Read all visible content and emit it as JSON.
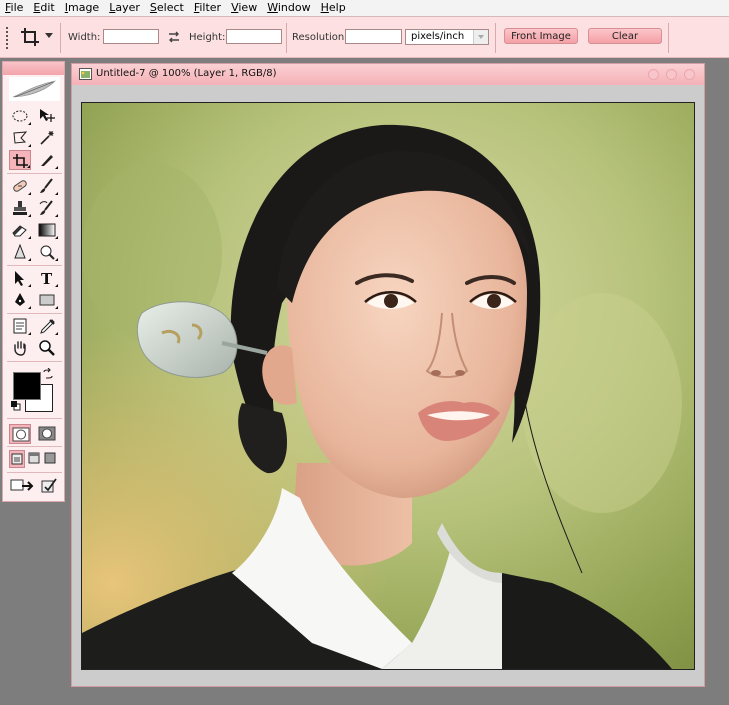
{
  "menu": [
    {
      "pre": "",
      "u": "F",
      "post": "ile"
    },
    {
      "pre": "",
      "u": "E",
      "post": "dit"
    },
    {
      "pre": "",
      "u": "I",
      "post": "mage"
    },
    {
      "pre": "",
      "u": "L",
      "post": "ayer"
    },
    {
      "pre": "",
      "u": "S",
      "post": "elect"
    },
    {
      "pre": "",
      "u": "F",
      "post": "ilter"
    },
    {
      "pre": "",
      "u": "V",
      "post": "iew"
    },
    {
      "pre": "",
      "u": "W",
      "post": "indow"
    },
    {
      "pre": "",
      "u": "H",
      "post": "elp"
    }
  ],
  "options": {
    "width_label": "Width:",
    "width_value": "",
    "height_label": "Height:",
    "height_value": "",
    "resolution_label": "Resolution:",
    "resolution_value": "",
    "resolution_unit": "pixels/inch",
    "front_image": "Front Image",
    "clear": "Clear"
  },
  "document": {
    "title": "Untitled-7 @ 100% (Layer 1, RGB/8)"
  },
  "colors": {
    "accent": "#f4b1b6",
    "foreground": "#000000",
    "background": "#ffffff"
  },
  "active_tool": "crop-tool"
}
